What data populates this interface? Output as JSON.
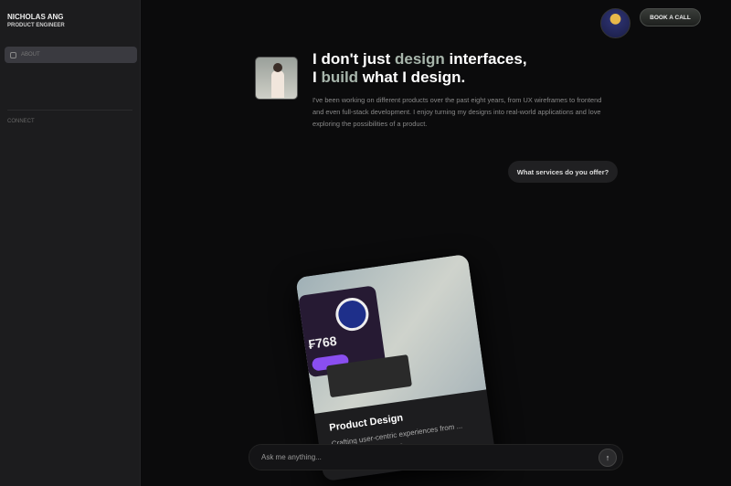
{
  "sidebar": {
    "name": "NICHOLAS ANG",
    "role": "PRODUCT ENGINEER",
    "nav": [
      {
        "label": "ABOUT",
        "active": true
      }
    ],
    "section": "CONNECT"
  },
  "header": {
    "book_label": "BOOK A CALL"
  },
  "hero": {
    "line1_a": "I don't just ",
    "line1_b": "design",
    "line1_c": " interfaces,",
    "line2_a": "I ",
    "line2_b": "build",
    "line2_c": " what I design.",
    "bio": "I've been working on different products over the past eight years, from UX wireframes to frontend and even full-stack development. I enjoy turning my designs into real-world applications and love exploring the possibilities of a product."
  },
  "chat": {
    "question": "What services do you offer?"
  },
  "card": {
    "title": "Product Design",
    "desc": "Crafting user-centric experiences from ... high-fidelity interfaces —",
    "price": "₣768"
  },
  "input": {
    "placeholder": "Ask me anything...",
    "send_icon": "arrow-up"
  },
  "colors": {
    "accent": "#a7b5ab",
    "background": "#0b0b0c"
  }
}
